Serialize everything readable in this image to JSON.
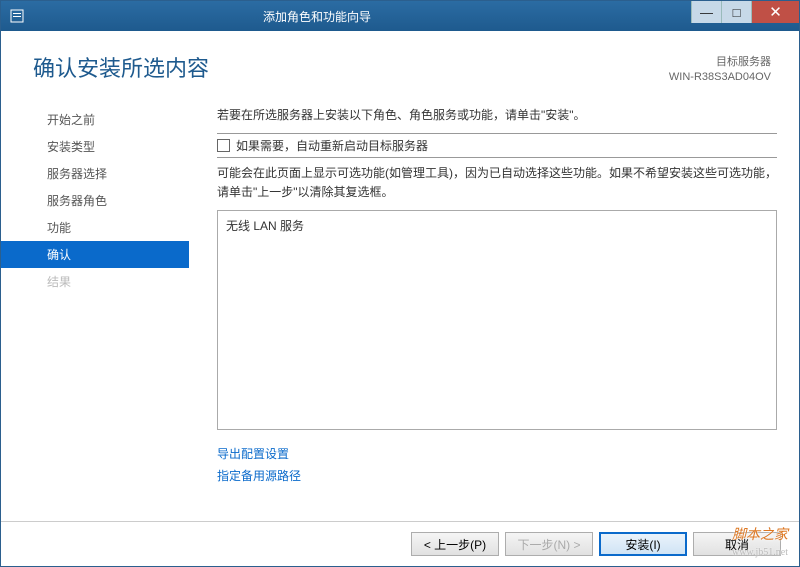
{
  "titlebar": {
    "title": "添加角色和功能向导"
  },
  "header": {
    "heading": "确认安装所选内容",
    "target_label": "目标服务器",
    "target_server": "WIN-R38S3AD04OV"
  },
  "steps": {
    "before": "开始之前",
    "install_type": "安装类型",
    "server_select": "服务器选择",
    "server_roles": "服务器角色",
    "features": "功能",
    "confirm": "确认",
    "results": "结果"
  },
  "main": {
    "intro": "若要在所选服务器上安装以下角色、角色服务或功能，请单击\"安装\"。",
    "checkbox_label": "如果需要，自动重新启动目标服务器",
    "note": "可能会在此页面上显示可选功能(如管理工具)，因为已自动选择这些功能。如果不希望安装这些可选功能，请单击\"上一步\"以清除其复选框。",
    "list_item": "无线 LAN 服务",
    "link_export": "导出配置设置",
    "link_alt_source": "指定备用源路径"
  },
  "footer": {
    "prev": "< 上一步(P)",
    "next": "下一步(N) >",
    "install": "安装(I)",
    "cancel": "取消"
  },
  "watermark": {
    "name": "脚本之家",
    "url": "www.jb51.net"
  }
}
